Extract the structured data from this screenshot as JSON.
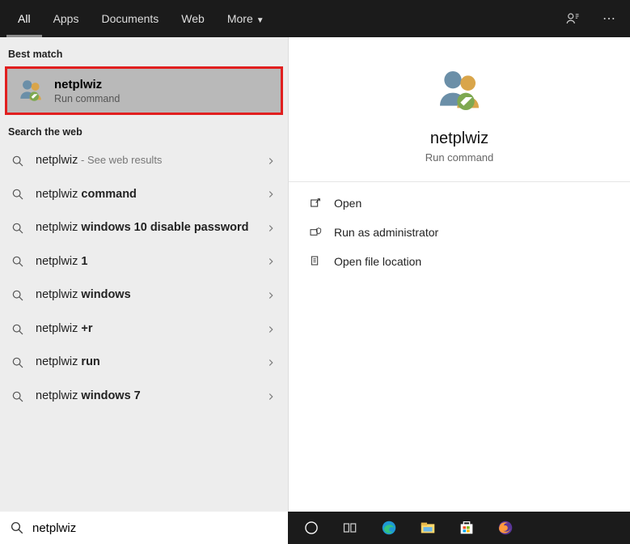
{
  "tabs": {
    "all": "All",
    "apps": "Apps",
    "documents": "Documents",
    "web": "Web",
    "more": "More"
  },
  "sections": {
    "best_match": "Best match",
    "search_web": "Search the web"
  },
  "best_match": {
    "title": "netplwiz",
    "subtitle": "Run command"
  },
  "web_results": [
    {
      "prefix": "netplwiz",
      "bold": "",
      "suffix": " - See web results",
      "suffixFaint": true
    },
    {
      "prefix": "netplwiz ",
      "bold": "command",
      "suffix": ""
    },
    {
      "prefix": "netplwiz ",
      "bold": "windows 10 disable password",
      "suffix": ""
    },
    {
      "prefix": "netplwiz ",
      "bold": "1",
      "suffix": ""
    },
    {
      "prefix": "netplwiz ",
      "bold": "windows",
      "suffix": ""
    },
    {
      "prefix": "netplwiz ",
      "bold": "+r",
      "suffix": ""
    },
    {
      "prefix": "netplwiz ",
      "bold": "run",
      "suffix": ""
    },
    {
      "prefix": "netplwiz ",
      "bold": "windows 7",
      "suffix": ""
    }
  ],
  "detail": {
    "title": "netplwiz",
    "subtitle": "Run command",
    "actions": {
      "open": "Open",
      "run_admin": "Run as administrator",
      "open_location": "Open file location"
    }
  },
  "search": {
    "value": "netplwiz"
  }
}
